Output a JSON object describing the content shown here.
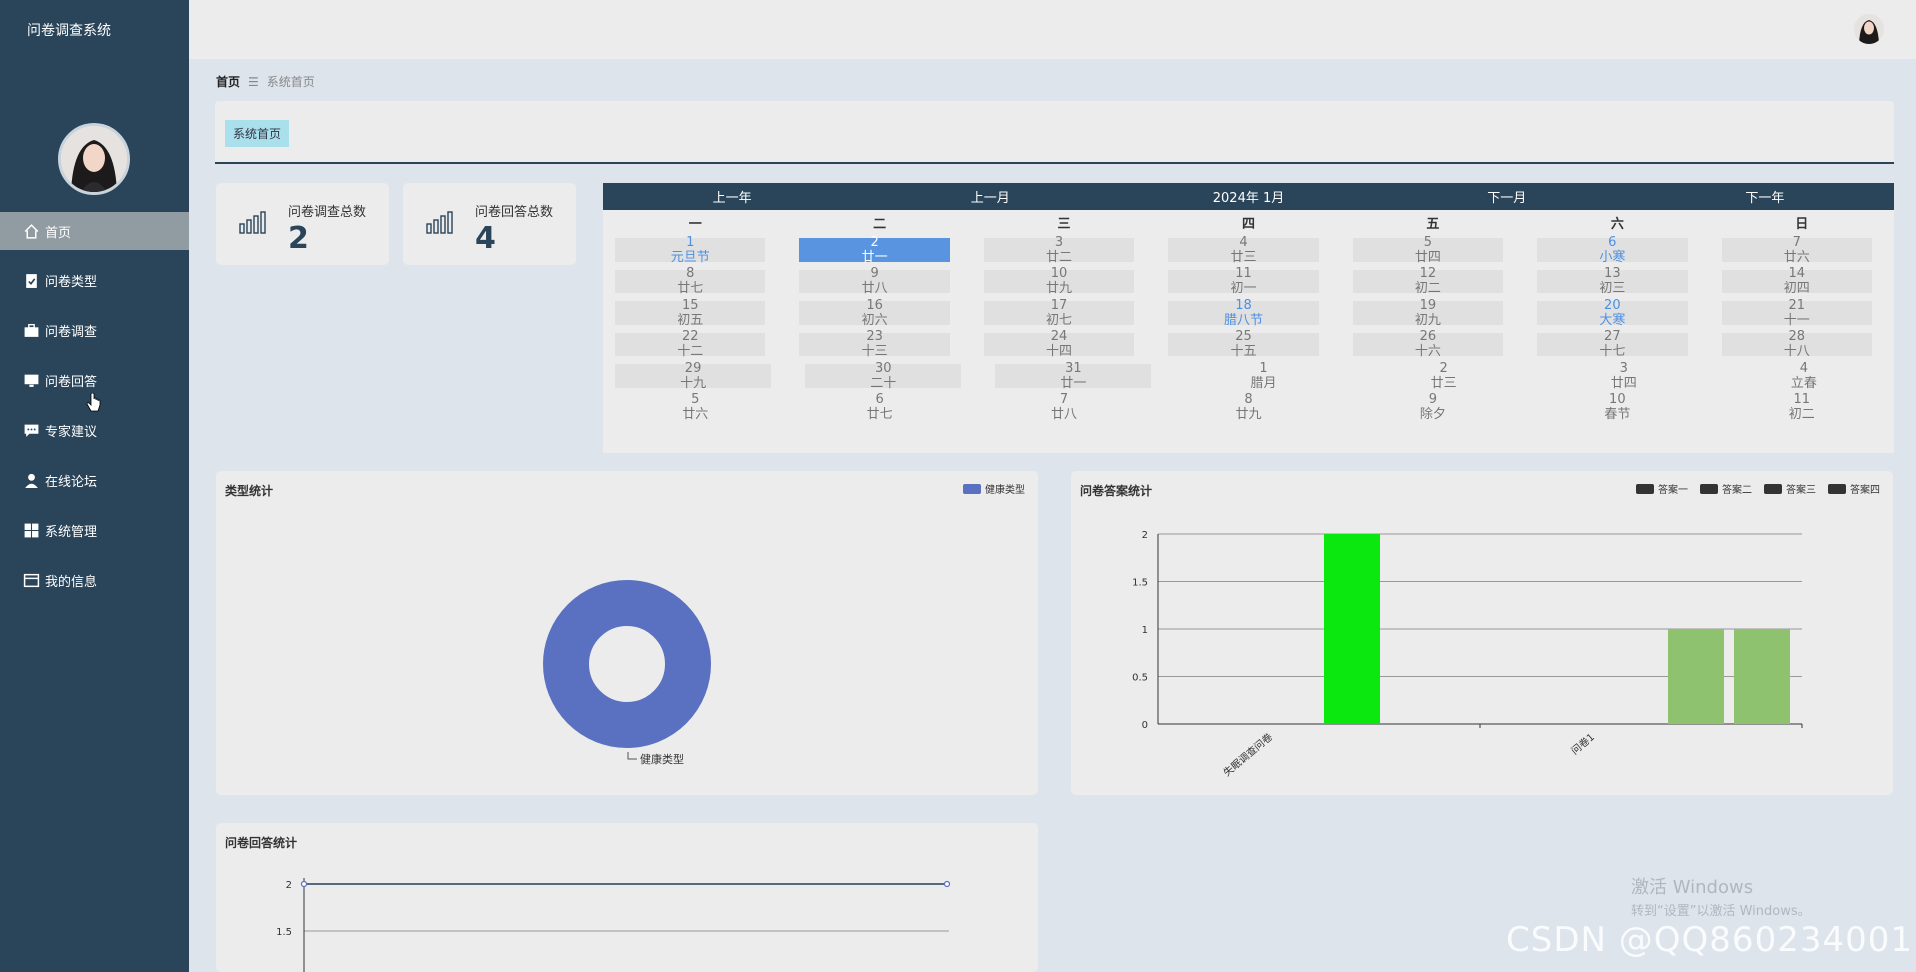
{
  "app": {
    "title": "问卷调查系统"
  },
  "sidebar": {
    "items": [
      {
        "label": "首页",
        "icon": "home-icon",
        "active": true
      },
      {
        "label": "问卷类型",
        "icon": "clipboard-icon"
      },
      {
        "label": "问卷调查",
        "icon": "briefcase-icon"
      },
      {
        "label": "问卷回答",
        "icon": "monitor-icon"
      },
      {
        "label": "专家建议",
        "icon": "chat-icon"
      },
      {
        "label": "在线论坛",
        "icon": "user-icon"
      },
      {
        "label": "系统管理",
        "icon": "grid-icon"
      },
      {
        "label": "我的信息",
        "icon": "id-card-icon"
      }
    ]
  },
  "breadcrumb": {
    "home": "首页",
    "separator": "☰",
    "current": "系统首页"
  },
  "header": {
    "tag": "系统首页"
  },
  "stats": [
    {
      "label": "问卷调查总数",
      "value": "2",
      "icon": "bar-chart-icon"
    },
    {
      "label": "问卷回答总数",
      "value": "4",
      "icon": "bar-chart-icon"
    }
  ],
  "calendar": {
    "nav": {
      "prev_year": "上一年",
      "prev_month": "上一月",
      "title": "2024年 1月",
      "next_month": "下一月",
      "next_year": "下一年"
    },
    "weekdays": [
      "一",
      "二",
      "三",
      "四",
      "五",
      "六",
      "日"
    ],
    "rows": [
      [
        {
          "d": "1",
          "l": "元旦节",
          "cur": true,
          "hol": true
        },
        {
          "d": "2",
          "l": "廿一",
          "cur": true,
          "today": true
        },
        {
          "d": "3",
          "l": "廿二",
          "cur": true
        },
        {
          "d": "4",
          "l": "廿三",
          "cur": true
        },
        {
          "d": "5",
          "l": "廿四",
          "cur": true
        },
        {
          "d": "6",
          "l": "小寒",
          "cur": true,
          "hol": true
        },
        {
          "d": "7",
          "l": "廿六",
          "cur": true
        }
      ],
      [
        {
          "d": "8",
          "l": "廿七",
          "cur": true
        },
        {
          "d": "9",
          "l": "廿八",
          "cur": true
        },
        {
          "d": "10",
          "l": "廿九",
          "cur": true
        },
        {
          "d": "11",
          "l": "初一",
          "cur": true
        },
        {
          "d": "12",
          "l": "初二",
          "cur": true
        },
        {
          "d": "13",
          "l": "初三",
          "cur": true
        },
        {
          "d": "14",
          "l": "初四",
          "cur": true
        }
      ],
      [
        {
          "d": "15",
          "l": "初五",
          "cur": true
        },
        {
          "d": "16",
          "l": "初六",
          "cur": true
        },
        {
          "d": "17",
          "l": "初七",
          "cur": true
        },
        {
          "d": "18",
          "l": "腊八节",
          "cur": true,
          "hol": true
        },
        {
          "d": "19",
          "l": "初九",
          "cur": true
        },
        {
          "d": "20",
          "l": "大寒",
          "cur": true,
          "hol": true
        },
        {
          "d": "21",
          "l": "十一",
          "cur": true
        }
      ],
      [
        {
          "d": "22",
          "l": "十二",
          "cur": true
        },
        {
          "d": "23",
          "l": "十三",
          "cur": true
        },
        {
          "d": "24",
          "l": "十四",
          "cur": true
        },
        {
          "d": "25",
          "l": "十五",
          "cur": true
        },
        {
          "d": "26",
          "l": "十六",
          "cur": true
        },
        {
          "d": "27",
          "l": "十七",
          "cur": true
        },
        {
          "d": "28",
          "l": "十八",
          "cur": true
        }
      ],
      [
        {
          "d": "29",
          "l": "十九",
          "cur": true
        },
        {
          "d": "30",
          "l": "二十",
          "cur": true
        },
        {
          "d": "31",
          "l": "廿一",
          "cur": true
        },
        {
          "d": "1",
          "l": "腊月"
        },
        {
          "d": "2",
          "l": "廿三"
        },
        {
          "d": "3",
          "l": "廿四"
        },
        {
          "d": "4",
          "l": "立春"
        }
      ],
      [
        {
          "d": "5",
          "l": "廿六"
        },
        {
          "d": "6",
          "l": "廿七"
        },
        {
          "d": "7",
          "l": "廿八"
        },
        {
          "d": "8",
          "l": "廿九"
        },
        {
          "d": "9",
          "l": "除夕"
        },
        {
          "d": "10",
          "l": "春节"
        },
        {
          "d": "11",
          "l": "初二"
        }
      ]
    ]
  },
  "chart_data": [
    {
      "type": "pie",
      "title": "类型统计",
      "legend": [
        "健康类型"
      ],
      "legend_position": "top-right",
      "slices": [
        {
          "name": "健康类型",
          "value": 1,
          "color": "#5a70c0"
        }
      ],
      "donut": true
    },
    {
      "type": "bar",
      "title": "问卷答案统计",
      "legend_position": "top-right",
      "categories": [
        "失眠调查问卷",
        "问卷1"
      ],
      "ylim": [
        0,
        2
      ],
      "yticks": [
        "0",
        "0.5",
        "1",
        "1.5",
        "2"
      ],
      "series": [
        {
          "name": "答案一",
          "values": [
            2,
            1
          ],
          "colors": [
            "#0ae80f",
            "#8ec26e"
          ]
        },
        {
          "name": "答案二",
          "values": [
            0,
            1
          ],
          "colors": [
            "#8ec26e",
            "#8ec26e"
          ]
        },
        {
          "name": "答案三",
          "values": [
            0,
            0
          ]
        },
        {
          "name": "答案四",
          "values": [
            0,
            0
          ]
        }
      ],
      "legend_color": "#333333"
    },
    {
      "type": "line",
      "title": "问卷回答统计",
      "ylim": [
        1.5,
        2
      ],
      "yticks": [
        "2",
        "1.5"
      ],
      "series": [
        {
          "values": [
            2,
            2
          ],
          "color": "#5a70c0"
        }
      ]
    }
  ],
  "watermark": {
    "text": "CSDN @QQ860234001",
    "win_title": "激活 Windows",
    "win_sub": "转到“设置”以激活 Windows。"
  }
}
